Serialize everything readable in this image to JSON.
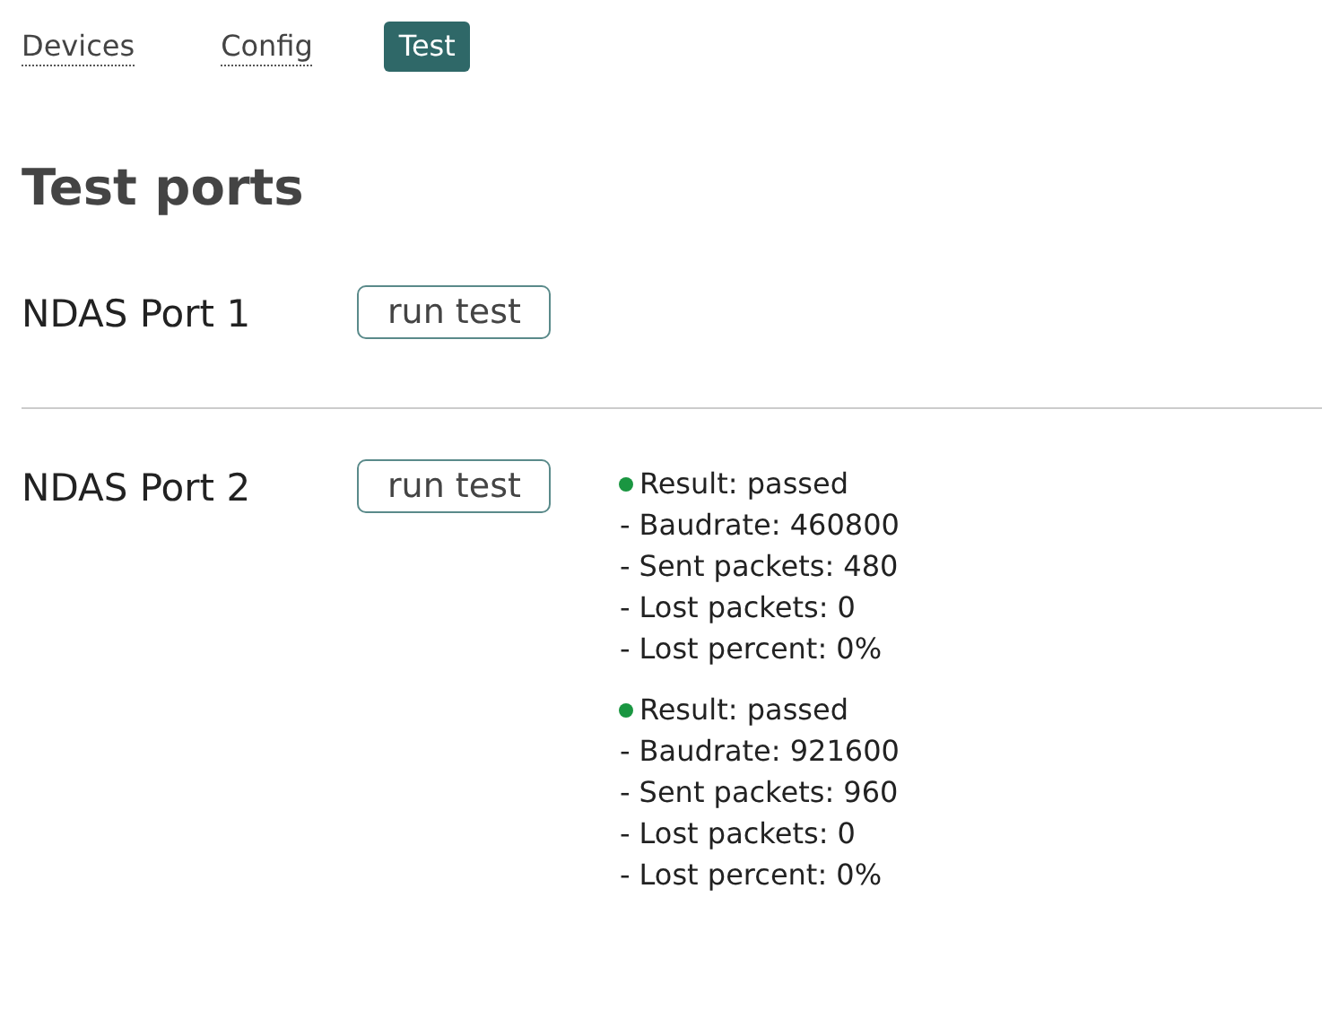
{
  "tabs": [
    {
      "label": "Devices",
      "selected": false
    },
    {
      "label": "Config",
      "selected": false
    },
    {
      "label": "Test",
      "selected": true
    }
  ],
  "heading": "Test ports",
  "ports": [
    {
      "name": "NDAS Port 1",
      "button": "run test"
    },
    {
      "name": "NDAS Port 2",
      "button": "run test",
      "results": [
        {
          "color": "#1a9641",
          "result": "Result: passed",
          "lines": [
            "- Baudrate: 460800",
            "- Sent packets: 480",
            "- Lost packets: 0",
            "- Lost percent: 0%"
          ]
        },
        {
          "color": "#1a9641",
          "result": "Result: passed",
          "lines": [
            "- Baudrate: 921600",
            "- Sent packets: 960",
            "- Lost packets: 0",
            "- Lost percent: 0%"
          ]
        }
      ]
    }
  ]
}
